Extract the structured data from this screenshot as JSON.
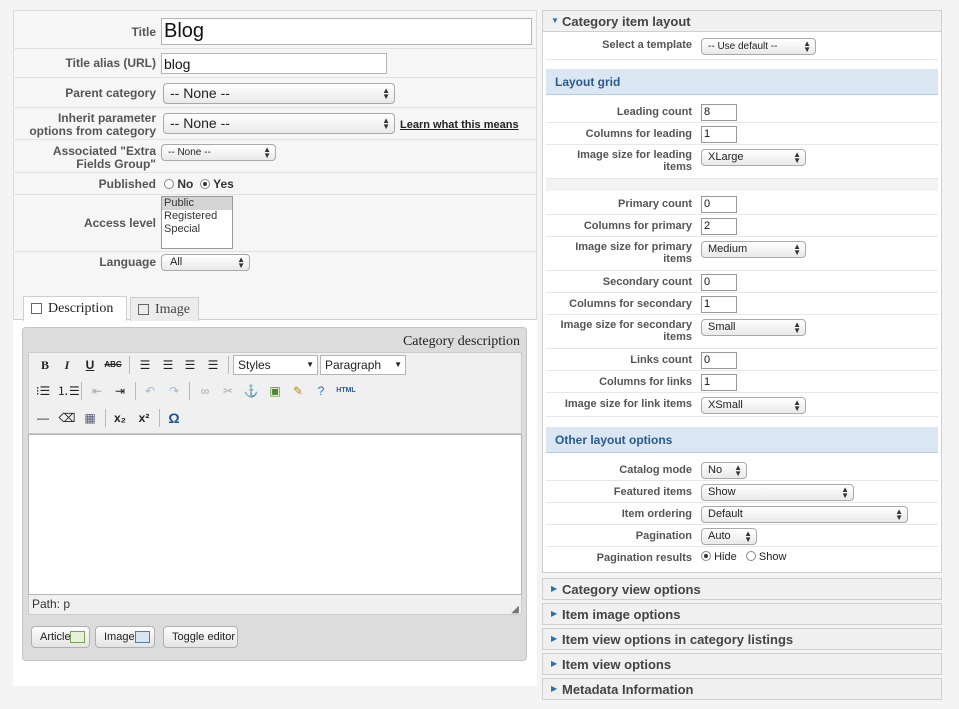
{
  "form": {
    "title_label": "Title",
    "title_value": "Blog",
    "alias_label": "Title alias (URL)",
    "alias_value": "blog",
    "parent_label": "Parent category",
    "parent_value": "-- None --",
    "inherit_label_1": "Inherit parameter",
    "inherit_label_2": "options from category",
    "inherit_value": "-- None --",
    "learn_link": "Learn what this means",
    "extra_label_1": "Associated \"Extra",
    "extra_label_2": "Fields Group\"",
    "extra_value": "-- None --",
    "published_label": "Published",
    "published_no": "No",
    "published_yes": "Yes",
    "access_label": "Access level",
    "access_options": [
      "Public",
      "Registered",
      "Special"
    ],
    "language_label": "Language",
    "language_value": "All"
  },
  "tabs": {
    "description": "Description",
    "image": "Image"
  },
  "editor": {
    "heading": "Category description",
    "styles": "Styles",
    "format": "Paragraph",
    "path": "Path: p",
    "html_label": "HTML",
    "buttons": {
      "article": "Article",
      "image": "Image",
      "toggle": "Toggle editor"
    }
  },
  "right": {
    "accordion_layout": "Category item layout",
    "template_label": "Select a template",
    "template_value": "-- Use default --",
    "layout_grid": "Layout grid",
    "leading_count_label": "Leading count",
    "leading_count": "8",
    "columns_leading_label": "Columns for leading",
    "columns_leading": "1",
    "img_leading_label_1": "Image size for leading",
    "img_leading_label_2": "items",
    "img_leading": "XLarge",
    "primary_count_label": "Primary count",
    "primary_count": "0",
    "columns_primary_label": "Columns for primary",
    "columns_primary": "2",
    "img_primary_label_1": "Image size for primary",
    "img_primary_label_2": "items",
    "img_primary": "Medium",
    "secondary_count_label": "Secondary count",
    "secondary_count": "0",
    "columns_secondary_label": "Columns for secondary",
    "columns_secondary": "1",
    "img_secondary_label_1": "Image size for secondary",
    "img_secondary_label_2": "items",
    "img_secondary": "Small",
    "links_count_label": "Links count",
    "links_count": "0",
    "columns_links_label": "Columns for links",
    "columns_links": "1",
    "img_links_label": "Image size for link items",
    "img_links": "XSmall",
    "other_options": "Other layout options",
    "catalog_label": "Catalog mode",
    "catalog_value": "No",
    "featured_label": "Featured items",
    "featured_value": "Show",
    "ordering_label": "Item ordering",
    "ordering_value": "Default",
    "pagination_label": "Pagination",
    "pagination_value": "Auto",
    "pag_results_label": "Pagination results",
    "pag_hide": "Hide",
    "pag_show": "Show",
    "acc_category_view": "Category view options",
    "acc_item_image": "Item image options",
    "acc_item_view_cat": "Item view options in category listings",
    "acc_item_view": "Item view options",
    "acc_metadata": "Metadata Information"
  }
}
